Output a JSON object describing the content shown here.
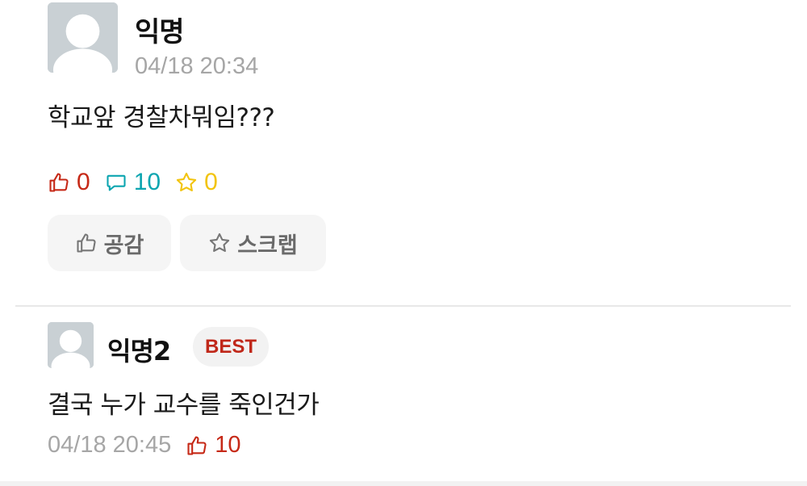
{
  "post": {
    "author": "익명",
    "datetime": "04/18 20:34",
    "content": "학교앞 경찰차뭐임???",
    "stats": {
      "likes": "0",
      "comments": "10",
      "scraps": "0"
    },
    "buttons": {
      "like_label": "공감",
      "scrap_label": "스크랩"
    }
  },
  "comment": {
    "author": "익명2",
    "badge": "BEST",
    "content": "결국 누가 교수를 죽인건가",
    "datetime": "04/18 20:45",
    "likes": "10"
  },
  "colors": {
    "like": "#c62917",
    "comment": "#0ca5b0",
    "scrap": "#f2c40f",
    "meta_gray": "#a6a6a6",
    "avatar_bg": "#c9d0d4"
  },
  "icons": {
    "like": "thumbs-up-icon",
    "comment": "speech-bubble-icon",
    "scrap": "star-icon",
    "avatar": "default-avatar-icon"
  }
}
